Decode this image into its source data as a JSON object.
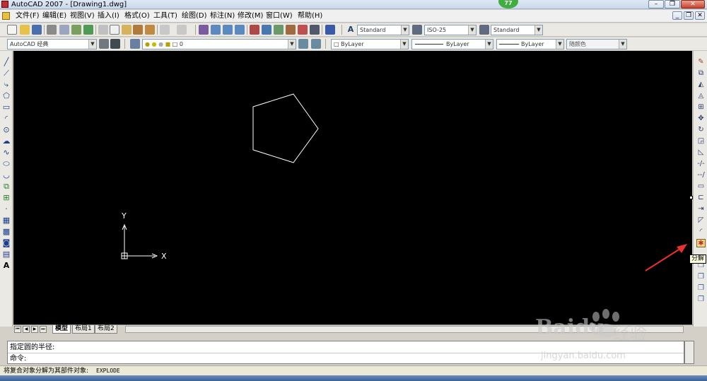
{
  "window": {
    "title": "AutoCAD 2007 - [Drawing1.dwg]",
    "badge": "77",
    "min_label": "–",
    "restore_label": "❐",
    "close_label": "✕",
    "doc_min_label": "_",
    "doc_restore_label": "❐",
    "doc_close_label": "✕"
  },
  "menu": {
    "items": [
      "文件(F)",
      "编辑(E)",
      "视图(V)",
      "插入(I)",
      "格式(O)",
      "工具(T)",
      "绘图(D)",
      "标注(N)",
      "修改(M)",
      "窗口(W)",
      "帮助(H)"
    ]
  },
  "styles_toolbar": {
    "text_style": "Standard",
    "dim_style": "ISO-25",
    "table_style": "Standard"
  },
  "layers_toolbar": {
    "workspace": "AutoCAD 经典",
    "layer": "0",
    "color": "ByLayer",
    "linetype": "ByLayer",
    "lineweight": "ByLayer",
    "plotstyle": "随颜色"
  },
  "canvas": {
    "background": "#000000",
    "shape_color": "#ffffff",
    "axis_y": "Y",
    "axis_x": "X"
  },
  "layout_tabs": [
    "模型",
    "布局1",
    "布局2"
  ],
  "command": {
    "line1": "指定圆的半径:",
    "line2": "命令:"
  },
  "status": {
    "description": "将复合对象分解为其部件对象:",
    "command": "EXPLODE"
  },
  "tooltip": {
    "text": "分解"
  },
  "watermark": {
    "brand_text": "Baidu",
    "brand_cn": "经验",
    "url": "jingyan.baidu.com"
  },
  "annotation": {
    "arrow_color": "#e8332a"
  }
}
